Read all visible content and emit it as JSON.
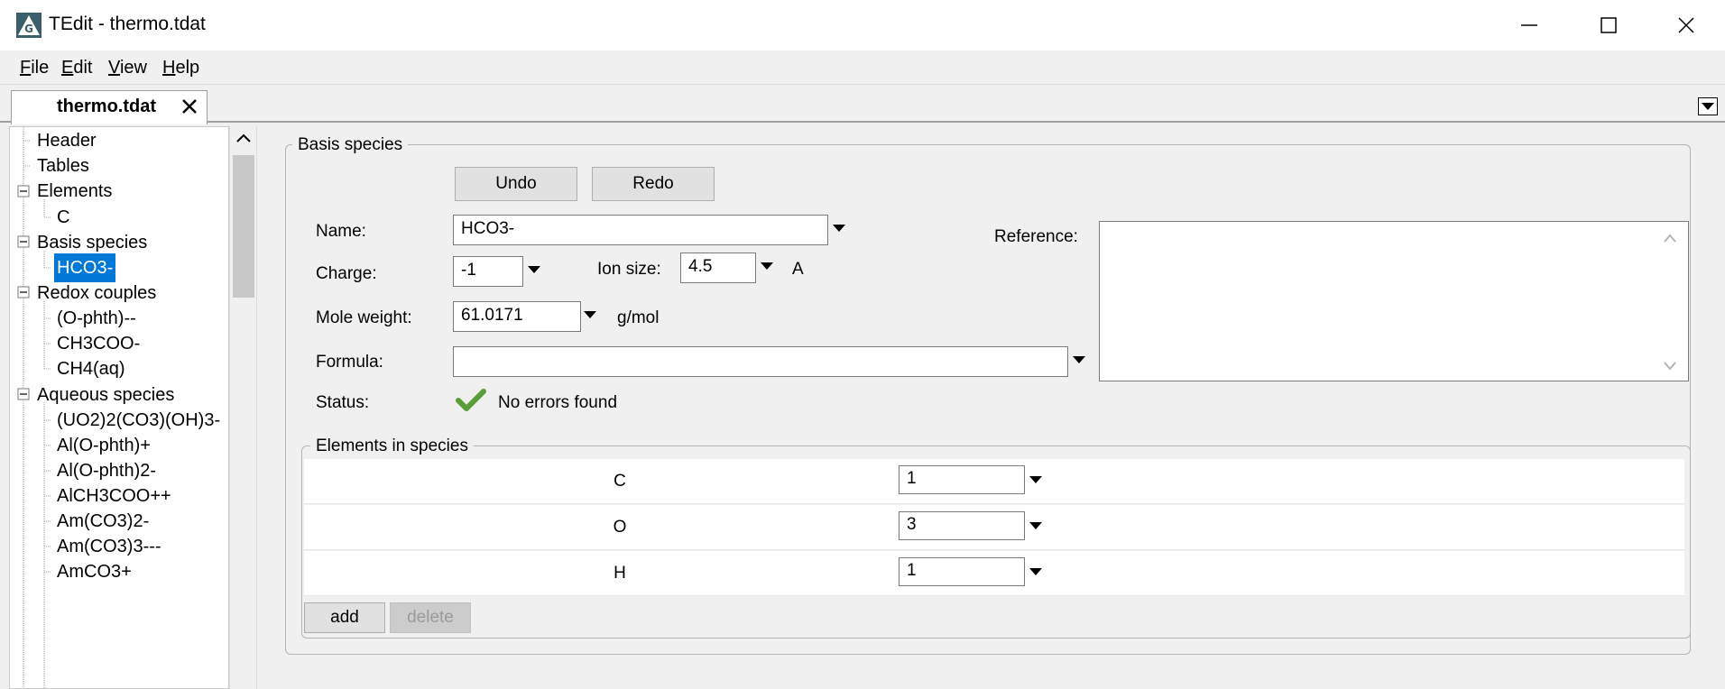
{
  "window": {
    "title": "TEdit - thermo.tdat"
  },
  "menu": [
    "File",
    "Edit",
    "View",
    "Help"
  ],
  "tab": {
    "label": "thermo.tdat"
  },
  "tree": {
    "items": [
      {
        "label": "Header",
        "level": 0
      },
      {
        "label": "Tables",
        "level": 0
      },
      {
        "label": "Elements",
        "level": 0
      },
      {
        "label": "C",
        "level": 1
      },
      {
        "label": "Basis species",
        "level": 0
      },
      {
        "label": "HCO3-",
        "level": 1
      },
      {
        "label": "Redox couples",
        "level": 0
      },
      {
        "label": "(O-phth)--",
        "level": 1
      },
      {
        "label": "CH3COO-",
        "level": 1
      },
      {
        "label": "CH4(aq)",
        "level": 1
      },
      {
        "label": "Aqueous species",
        "level": 0
      },
      {
        "label": "(UO2)2(CO3)(OH)3-",
        "level": 1
      },
      {
        "label": "Al(O-phth)+",
        "level": 1
      },
      {
        "label": "Al(O-phth)2-",
        "level": 1
      },
      {
        "label": "AlCH3COO++",
        "level": 1
      },
      {
        "label": "Am(CO3)2-",
        "level": 1
      },
      {
        "label": "Am(CO3)3---",
        "level": 1
      },
      {
        "label": "AmCO3+",
        "level": 1
      }
    ]
  },
  "basis": {
    "group_title": "Basis species",
    "undo_label": "Undo",
    "redo_label": "Redo",
    "name_label": "Name:",
    "name_value": "HCO3-",
    "charge_label": "Charge:",
    "charge_value": "-1",
    "ion_size_label": "Ion size:",
    "ion_size_value": "4.5",
    "ion_size_unit": "A",
    "mole_weight_label": "Mole weight:",
    "mole_weight_value": "61.0171",
    "mole_weight_unit": "g/mol",
    "formula_label": "Formula:",
    "formula_value": "",
    "status_label": "Status:",
    "status_text": "No errors found",
    "reference_label": "Reference:",
    "reference_value": ""
  },
  "elements_in_species": {
    "group_title": "Elements in species",
    "rows": [
      {
        "element": "C",
        "count": "1"
      },
      {
        "element": "O",
        "count": "3"
      },
      {
        "element": "H",
        "count": "1"
      }
    ],
    "add_label": "add",
    "delete_label": "delete"
  },
  "colors": {
    "selection": "#0078d7",
    "status_ok": "#5a9e3a"
  }
}
